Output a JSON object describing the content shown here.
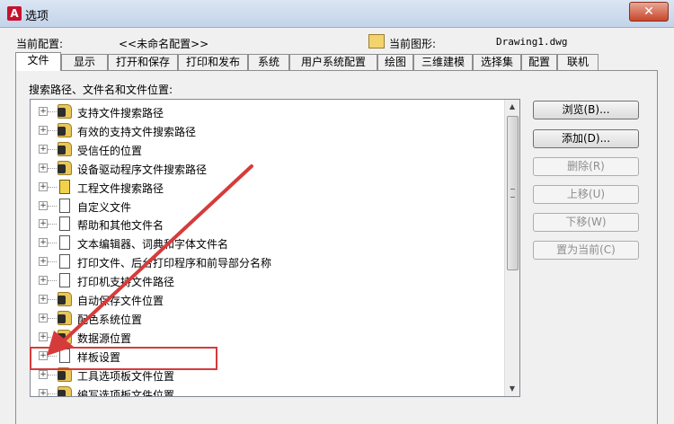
{
  "window": {
    "title": "选项",
    "close": "✕"
  },
  "profile": {
    "current_label": "当前配置:",
    "current_value": "<<未命名配置>>",
    "drawing_label": "当前图形:",
    "drawing_value": "Drawing1.dwg"
  },
  "tabs": [
    "文件",
    "显示",
    "打开和保存",
    "打印和发布",
    "系统",
    "用户系统配置",
    "绘图",
    "三维建模",
    "选择集",
    "配置",
    "联机"
  ],
  "tree": {
    "caption": "搜索路径、文件名和文件位置:",
    "items": [
      {
        "label": "支持文件搜索路径",
        "icon": "folder-icon"
      },
      {
        "label": "有效的支持文件搜索路径",
        "icon": "folder-icon"
      },
      {
        "label": "受信任的位置",
        "icon": "folder-icon"
      },
      {
        "label": "设备驱动程序文件搜索路径",
        "icon": "folder-icon"
      },
      {
        "label": "工程文件搜索路径",
        "icon": "project-icon"
      },
      {
        "label": "自定义文件",
        "icon": "document-icon"
      },
      {
        "label": "帮助和其他文件名",
        "icon": "document-icon"
      },
      {
        "label": "文本编辑器、词典和字体文件名",
        "icon": "document-icon"
      },
      {
        "label": "打印文件、后台打印程序和前导部分名称",
        "icon": "document-icon"
      },
      {
        "label": "打印机支持文件路径",
        "icon": "document-icon"
      },
      {
        "label": "自动保存文件位置",
        "icon": "folder-icon"
      },
      {
        "label": "配色系统位置",
        "icon": "folder-icon"
      },
      {
        "label": "数据源位置",
        "icon": "folder-icon"
      },
      {
        "label": "样板设置",
        "icon": "document-icon"
      },
      {
        "label": "工具选项板文件位置",
        "icon": "folder-icon"
      },
      {
        "label": "编写选项板文件位置",
        "icon": "folder-icon"
      }
    ]
  },
  "buttons": {
    "browse": "浏览(B)...",
    "add": "添加(D)...",
    "remove": "删除(R)",
    "move_up": "上移(U)",
    "move_down": "下移(W)",
    "set_current": "置为当前(C)"
  },
  "colors": {
    "highlight": "#d63b3b",
    "accent": "#c8102e"
  }
}
